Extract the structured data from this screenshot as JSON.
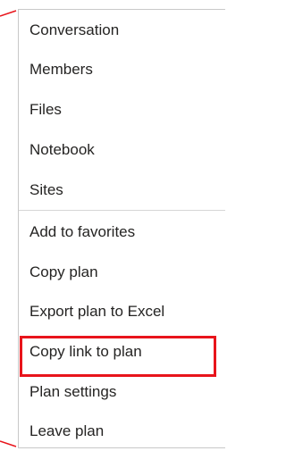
{
  "menu": {
    "items": [
      {
        "label": "Conversation"
      },
      {
        "label": "Members"
      },
      {
        "label": "Files"
      },
      {
        "label": "Notebook"
      },
      {
        "label": "Sites"
      },
      {
        "label": "Add to favorites"
      },
      {
        "label": "Copy plan"
      },
      {
        "label": "Export plan to Excel"
      },
      {
        "label": "Copy link to plan"
      },
      {
        "label": "Plan settings"
      },
      {
        "label": "Leave plan"
      }
    ],
    "highlighted_item": "Copy link to plan"
  },
  "colors": {
    "highlight": "#e8141b",
    "callout_line": "#e8141b",
    "text": "#252423",
    "border": "#c8c8c8"
  }
}
